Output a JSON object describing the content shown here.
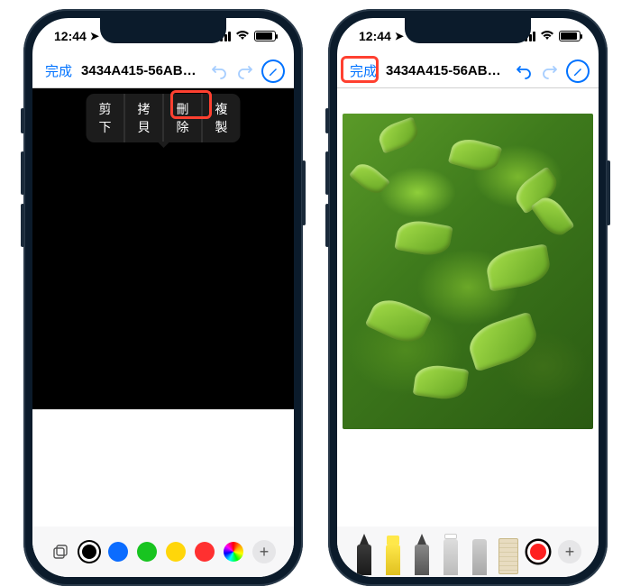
{
  "status": {
    "time": "12:44"
  },
  "nav": {
    "done": "完成",
    "title": "3434A415-56AB-..."
  },
  "context": {
    "cut": "剪下",
    "copy": "拷貝",
    "delete": "刪除",
    "duplicate": "複製"
  },
  "colors": {
    "black": "#000000",
    "blue": "#0b6cff",
    "green": "#18c420",
    "yellow": "#ffd60a",
    "red": "#ff3030",
    "purple": "#b442d8"
  }
}
